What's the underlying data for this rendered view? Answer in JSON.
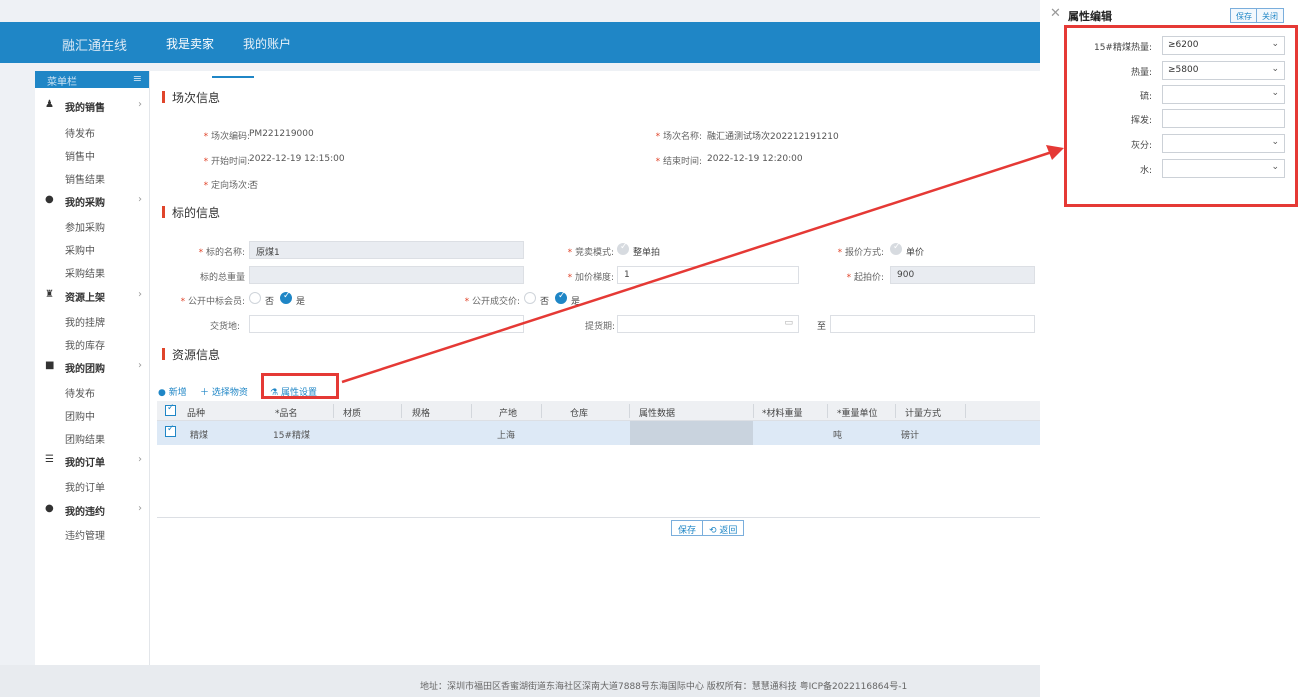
{
  "header": {
    "logo": "融汇通在线",
    "nav": [
      "我是卖家",
      "我的账户"
    ]
  },
  "sidebar": {
    "head": "菜单栏",
    "groups": [
      {
        "label": "我的销售",
        "items": [
          "待发布",
          "销售中",
          "销售结果"
        ]
      },
      {
        "label": "我的采购",
        "items": [
          "参加采购",
          "采购中",
          "采购结果"
        ]
      },
      {
        "label": "资源上架",
        "items": [
          "我的挂牌",
          "我的库存"
        ]
      },
      {
        "label": "我的团购",
        "items": [
          "待发布",
          "团购中",
          "团购结果"
        ]
      },
      {
        "label": "我的订单",
        "items": [
          "我的订单"
        ]
      },
      {
        "label": "我的违约",
        "items": [
          "违约管理"
        ]
      }
    ]
  },
  "session": {
    "title": "场次信息",
    "code_label": "场次编码:",
    "code": "PM221219000",
    "name_label": "场次名称:",
    "name": "融汇通测试场次202212191210",
    "start_label": "开始时间:",
    "start": "2022-12-19 12:15:00",
    "end_label": "结束时间:",
    "end": "2022-12-19 12:20:00",
    "directed_label": "定向场次:",
    "directed": "否"
  },
  "target": {
    "title": "标的信息",
    "name_label": "标的名称:",
    "name": "原煤1",
    "mode_label": "竞卖模式:",
    "mode": "整单拍",
    "quote_label": "报价方式:",
    "quote": "单价",
    "total_label": "标的总重量",
    "total": "",
    "step_label": "加价梯度:",
    "step": "1",
    "start_price_label": "起拍价:",
    "start_price": "900",
    "public_winner_label": "公开中标会员:",
    "public_price_label": "公开成交价:",
    "no": "否",
    "yes": "是",
    "delivery_label": "交货地:",
    "pickup_label": "提货期:",
    "to": "至"
  },
  "resource": {
    "title": "资源信息",
    "toolbar": {
      "add": "新增",
      "select": "选择物资",
      "attr": "属性设置"
    },
    "columns": [
      "品种",
      "*品名",
      "材质",
      "规格",
      "产地",
      "仓库",
      "属性数据",
      "*材料重量",
      "*重量单位",
      "计量方式"
    ],
    "row": {
      "variety": "精煤",
      "name": "15#精煤",
      "origin": "上海",
      "unit": "吨",
      "measure": "磅计"
    }
  },
  "actions": {
    "save": "保存",
    "back": "返回"
  },
  "footer": "地址：深圳市福田区香蜜湖街道东海社区深南大道7888号东海国际中心  版权所有：慧慧通科技  粤ICP备2022116864号-1",
  "panel": {
    "title": "属性编辑",
    "save": "保存",
    "close": "关闭",
    "fields": [
      {
        "label": "15#精煤热量:",
        "value": "≥6200"
      },
      {
        "label": "热量:",
        "value": "≥5800"
      },
      {
        "label": "硫:",
        "value": ""
      },
      {
        "label": "挥发:",
        "value": ""
      },
      {
        "label": "灰分:",
        "value": ""
      },
      {
        "label": "水:",
        "value": ""
      }
    ]
  },
  "colors": {
    "brand": "#1f86c6",
    "highlight": "#e53935"
  }
}
